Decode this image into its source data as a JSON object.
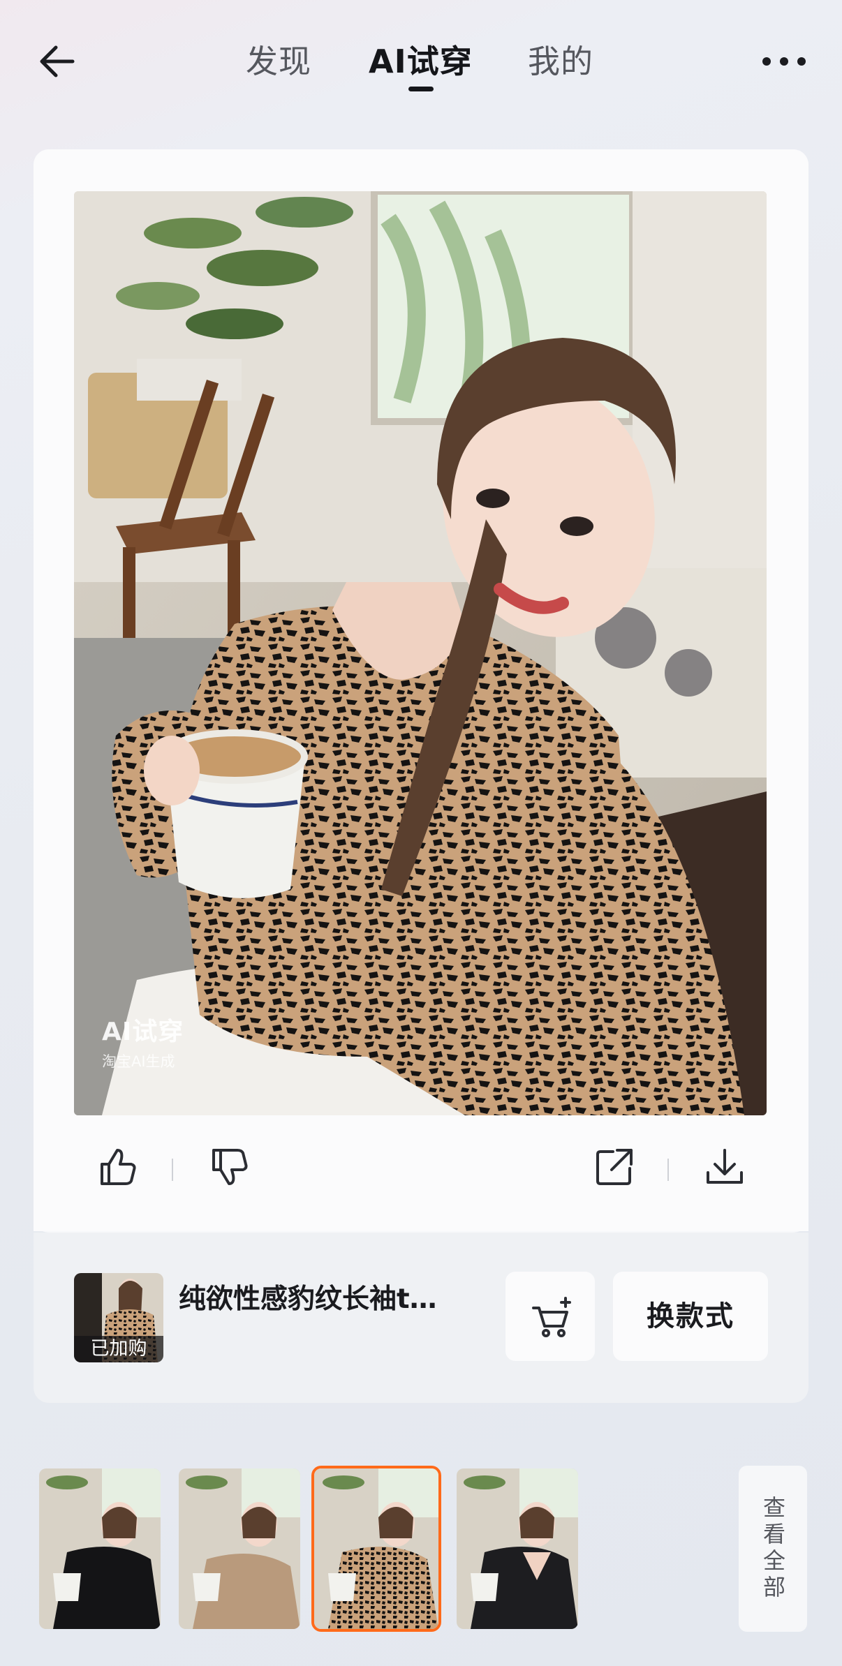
{
  "header": {
    "tabs": [
      {
        "label": "发现",
        "active": false
      },
      {
        "label": "AI试穿",
        "active": true
      },
      {
        "label": "我的",
        "active": false
      }
    ],
    "back_icon": "back-arrow-icon",
    "more_icon": "more-dots-icon"
  },
  "result": {
    "watermark_title": "AI试穿",
    "watermark_sub": "淘宝AI生成",
    "actions": [
      "thumbs-up-icon",
      "thumbs-down-icon",
      "share-icon",
      "download-icon"
    ]
  },
  "product": {
    "badge": "已加购",
    "title": "纯欲性感豹纹长袖t…",
    "cart_icon": "add-to-cart-icon",
    "change_label": "换款式"
  },
  "thumbnails": {
    "items": [
      {
        "outfit": "black jacket",
        "selected": false
      },
      {
        "outfit": "beige halter top",
        "selected": false
      },
      {
        "outfit": "leopard long sleeve",
        "selected": true
      },
      {
        "outfit": "black cardigan",
        "selected": false
      }
    ],
    "view_all_label": "查看全部"
  },
  "colors": {
    "accent": "#ff6a1a",
    "text_primary": "#15161a",
    "text_secondary": "#55575e"
  }
}
